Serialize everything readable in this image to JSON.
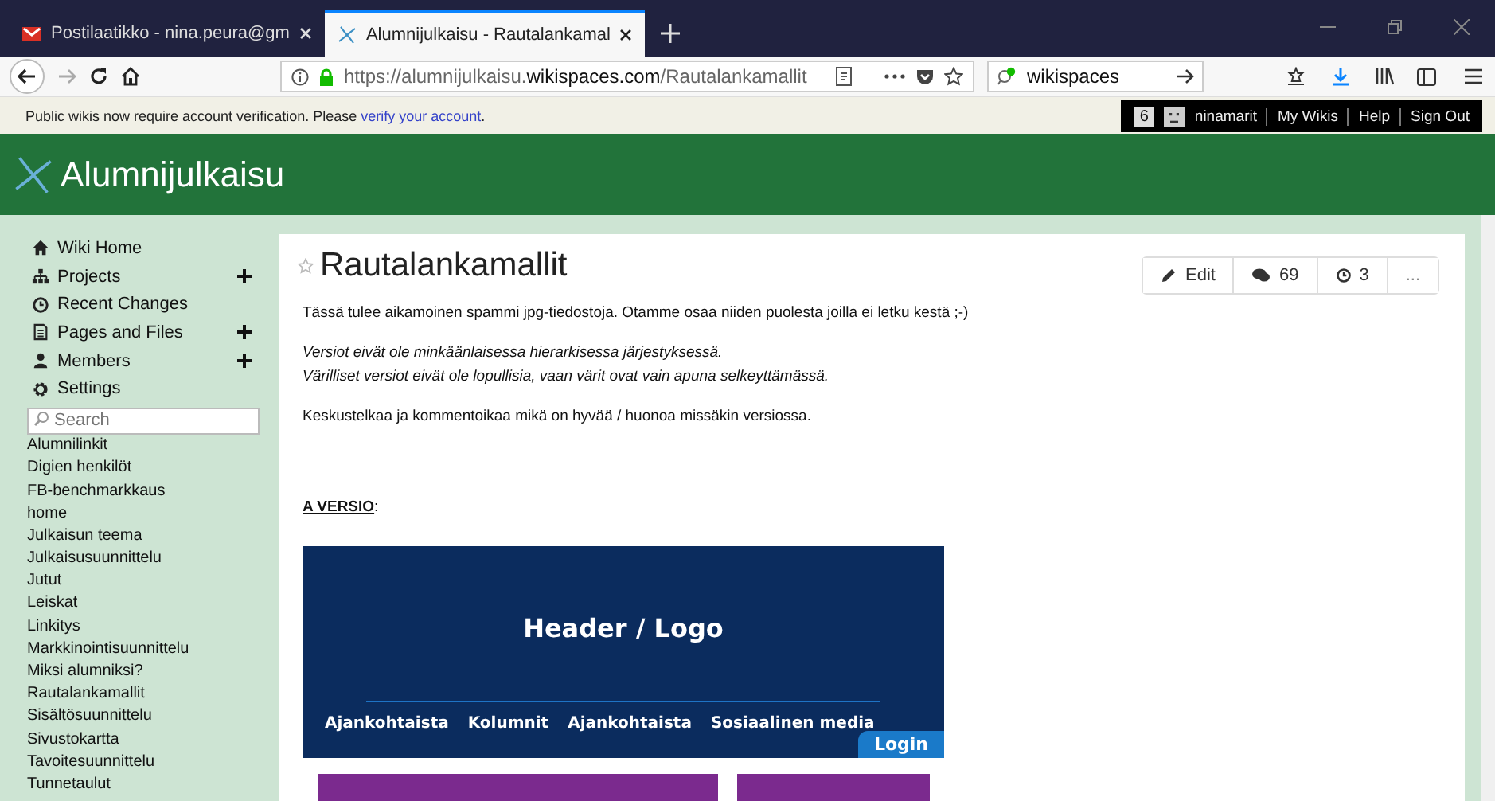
{
  "browser": {
    "tabs": [
      {
        "title": "Postilaatikko - nina.peura@gm",
        "kind": "mail",
        "selected": false
      },
      {
        "title": "Alumnijulkaisu - Rautalankamal",
        "kind": "wiki",
        "selected": true
      }
    ],
    "url": {
      "prefix": "https://alumnijulkaisu.",
      "domain": "wikispaces.com",
      "path": "/Rautalankamallit"
    },
    "search": {
      "value": "wikispaces"
    }
  },
  "notice": {
    "text": "Public wikis now require account verification. Please ",
    "link": "verify your account",
    "suffix": "."
  },
  "user_bar": {
    "count": "6",
    "username": "ninamarit",
    "links": [
      "My Wikis",
      "Help",
      "Sign Out"
    ]
  },
  "wiki": {
    "title": "Alumnijulkaisu"
  },
  "sidebar": {
    "nav": [
      {
        "label": "Wiki Home",
        "kind": "home",
        "expandable": false
      },
      {
        "label": "Projects",
        "kind": "tree",
        "expandable": true
      },
      {
        "label": "Recent Changes",
        "kind": "clock",
        "expandable": false
      },
      {
        "label": "Pages and Files",
        "kind": "file",
        "expandable": true
      },
      {
        "label": "Members",
        "kind": "person",
        "expandable": true
      },
      {
        "label": "Settings",
        "kind": "gear",
        "expandable": false
      }
    ],
    "search": {
      "placeholder": "Search"
    },
    "pages": [
      "Alumnilinkit",
      "Digien henkilöt",
      "FB-benchmarkkaus",
      "home",
      "Julkaisun teema",
      "Julkaisusuunnittelu",
      "Jutut",
      "Leiskat",
      "Linkitys",
      "Markkinointisuunnittelu",
      "Miksi alumniksi?",
      "Rautalankamallit",
      "Sisältösuunnittelu",
      "Sivustokartta",
      "Tavoitesuunnittelu",
      "Tunnetaulut"
    ]
  },
  "page": {
    "title": "Rautalankamallit",
    "actions": [
      {
        "kind": "edit",
        "label": "Edit"
      },
      {
        "kind": "comments",
        "label": "69"
      },
      {
        "kind": "history",
        "label": "3"
      },
      {
        "kind": "more",
        "label": "..."
      }
    ],
    "blocks": [
      {
        "kind": "text",
        "lines": [
          "Tässä tulee aikamoinen spammi jpg-tiedostoja. Otamme osaa niiden puolesta joilla ei letku kestä ;-)"
        ]
      },
      {
        "kind": "italic",
        "lines": [
          "Versiot eivät ole minkäänlaisessa hierarkisessa järjestyksessä.",
          "Värilliset versiot eivät ole lopullisia, vaan värit ovat vain apuna selkeyttämässä."
        ]
      },
      {
        "kind": "text",
        "lines": [
          "Keskustelkaa ja kommentoikaa mikä on hyvää / huonoa missäkin versiossa."
        ]
      },
      {
        "kind": "heading",
        "lines": [
          "**A VERSIO**:"
        ]
      }
    ],
    "mockup": {
      "header": "Header / Logo",
      "nav": [
        "Ajankohtaista",
        "Kolumnit",
        "Ajankohtaista",
        "Sosiaalinen media"
      ],
      "login": "Login"
    }
  }
}
